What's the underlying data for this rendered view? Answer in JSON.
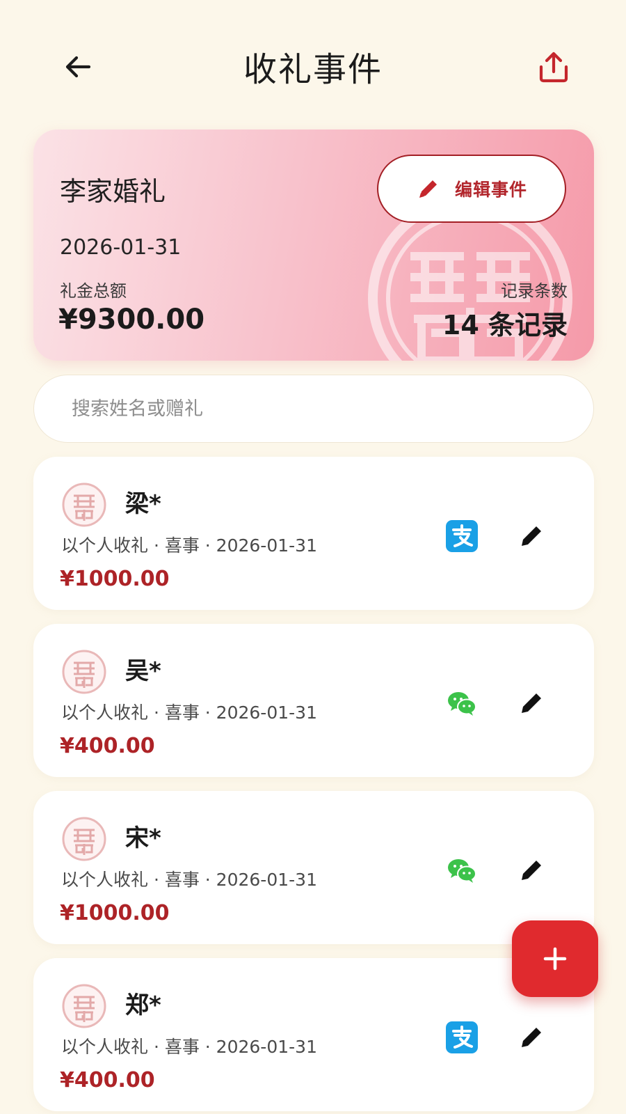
{
  "header": {
    "title": "收礼事件",
    "back_icon": "arrow-left-icon",
    "share_icon": "share-upload-icon"
  },
  "event": {
    "name": "李家婚礼",
    "date": "2026-01-31",
    "total_label": "礼金总额",
    "total_value": "¥9300.00",
    "count_label": "记录条数",
    "count_value": "14 条记录",
    "edit_label": "编辑事件",
    "edit_icon": "pencil-icon",
    "decoration": "double-happiness-seal"
  },
  "search": {
    "placeholder": "搜索姓名或赠礼",
    "value": ""
  },
  "records": [
    {
      "name": "梁*",
      "meta": "以个人收礼 · 喜事 · 2026-01-31",
      "amount": "¥1000.00",
      "payment": "alipay"
    },
    {
      "name": "吴*",
      "meta": "以个人收礼 · 喜事 · 2026-01-31",
      "amount": "¥400.00",
      "payment": "wechat"
    },
    {
      "name": "宋*",
      "meta": "以个人收礼 · 喜事 · 2026-01-31",
      "amount": "¥1000.00",
      "payment": "wechat"
    },
    {
      "name": "郑*",
      "meta": "以个人收礼 · 喜事 · 2026-01-31",
      "amount": "¥400.00",
      "payment": "alipay"
    }
  ],
  "fab": {
    "label": "+",
    "icon": "plus-icon"
  },
  "colors": {
    "background": "#fcf7ea",
    "accent_red": "#e02a2e",
    "amount_red": "#ad2327",
    "card_pink": "#f8c2cc",
    "alipay_blue": "#1aa0e6",
    "wechat_green": "#3cc24a"
  }
}
